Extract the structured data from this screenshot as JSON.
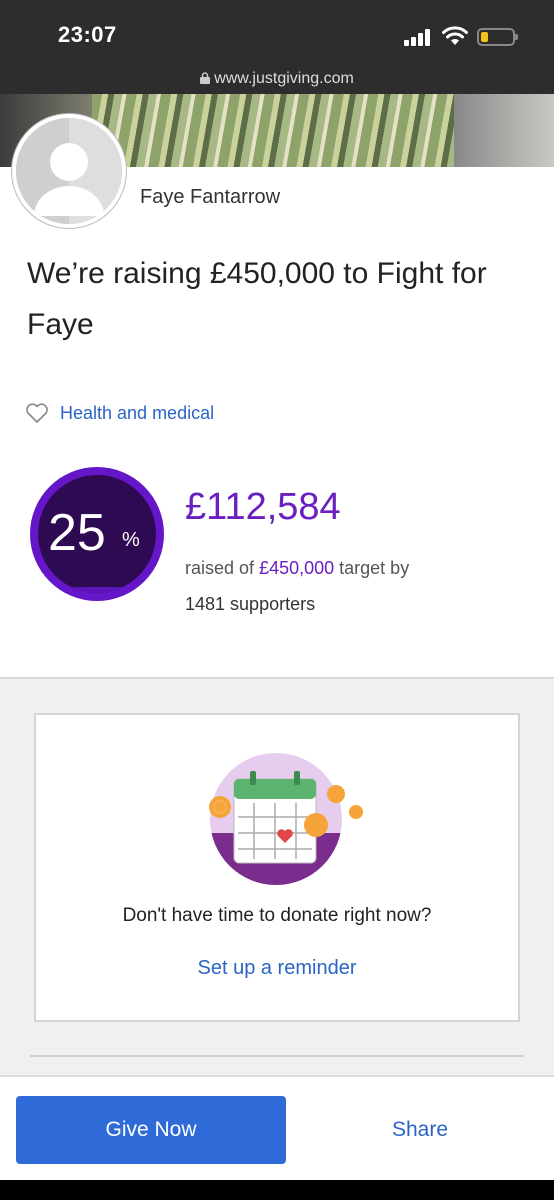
{
  "status": {
    "time": "23:07"
  },
  "browser": {
    "url": "www.justgiving.com"
  },
  "page": {
    "owner_name": "Faye Fantarrow",
    "title": "We’re raising £450,000 to Fight for Faye",
    "category": "Health and medical"
  },
  "progress": {
    "percent_num": "25",
    "percent_sign": "%",
    "percent_value": 25,
    "raised": "£112,584",
    "raised_prefix": "raised of",
    "target_amount": "£450,000",
    "target_suffix": "target by",
    "supporters": "1481 supporters"
  },
  "reminder": {
    "question": "Don't have time to donate right now?",
    "link": "Set up a reminder"
  },
  "actions": {
    "give_now": "Give Now",
    "share": "Share"
  },
  "colors": {
    "accent_purple": "#6a1fc0",
    "link_blue": "#2a64c6",
    "button_blue": "#2f6bd8"
  },
  "icons": [
    "lock-icon",
    "signal-icon",
    "wifi-icon",
    "battery-icon",
    "heart-outline-icon",
    "calendar-illustration"
  ]
}
